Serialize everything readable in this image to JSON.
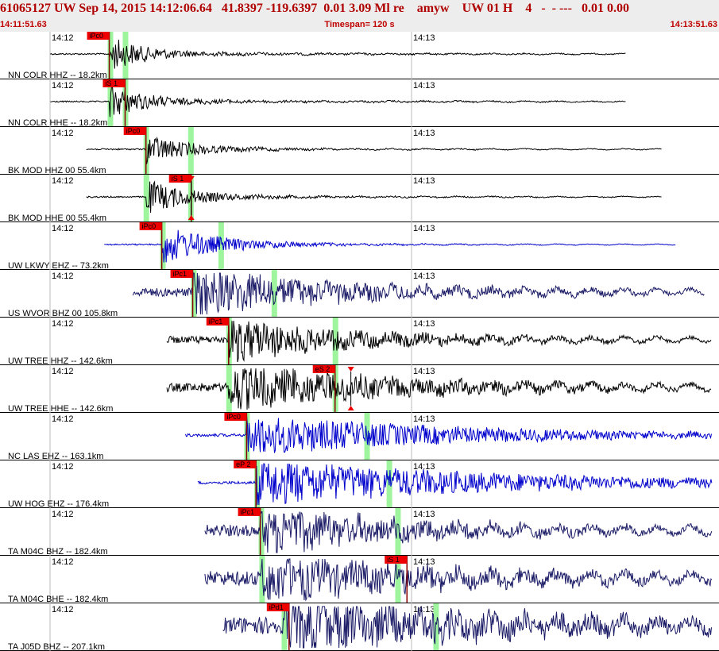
{
  "header": {
    "title": "61065127 UW Sep 14, 2015 14:12:06.64   41.8397 -119.6397  0.01 3.09 Ml re    amyw    UW 01 H    4   -  - ---   0.01 0.00",
    "start_time": "14:11:51.63",
    "timespan": "Timespan= 120 s",
    "end_time": "14:13:51.63"
  },
  "tick_labels": [
    "14:12",
    "14:13"
  ],
  "colors": {
    "black": "#000000",
    "blue": "#0000cc",
    "navy": "#1a1a66",
    "pick": "#ee0000",
    "window": "#9ef59e"
  },
  "traces": [
    {
      "label": "NN COLR HHZ -- 18.2km",
      "color": "black",
      "start": 0.07,
      "arrival": 0.152,
      "end": 0.87,
      "amp": 0.35,
      "noise": 0.01,
      "decay": 0.05,
      "coda": 0.1,
      "picks": [
        {
          "text": "iPc0",
          "x": 0.152,
          "label_at": "top"
        }
      ],
      "windows": [
        0.153,
        0.174
      ],
      "triangles": []
    },
    {
      "label": "NN COLR HHE -- 18.2km",
      "color": "black",
      "start": 0.07,
      "arrival": 0.152,
      "end": 0.87,
      "amp": 0.35,
      "noise": 0.01,
      "decay": 0.05,
      "coda": 0.1,
      "picks": [
        {
          "text": "iS 1",
          "x": 0.174,
          "label_at": "top"
        }
      ],
      "windows": [
        0.153,
        0.174
      ],
      "triangles": []
    },
    {
      "label": "BK MOD HHZ 00 55.4km",
      "color": "black",
      "start": 0.12,
      "arrival": 0.203,
      "end": 0.92,
      "amp": 0.3,
      "noise": 0.01,
      "decay": 0.06,
      "coda": 0.08,
      "picks": [
        {
          "text": "iPc0",
          "x": 0.203,
          "label_at": "top"
        }
      ],
      "windows": [
        0.203,
        0.265
      ],
      "triangles": []
    },
    {
      "label": "BK MOD HHE 00 55.4km",
      "color": "black",
      "start": 0.12,
      "arrival": 0.203,
      "end": 0.92,
      "amp": 0.35,
      "noise": 0.01,
      "decay": 0.06,
      "coda": 0.08,
      "picks": [
        {
          "text": "iS 1",
          "x": 0.266,
          "label_at": "top"
        }
      ],
      "windows": [
        0.203,
        0.265
      ],
      "triangles": [
        0.266
      ]
    },
    {
      "label": "UW LKWY EHZ -- 73.2km",
      "color": "blue",
      "start": 0.145,
      "arrival": 0.225,
      "end": 0.94,
      "amp": 0.4,
      "noise": 0.01,
      "decay": 0.08,
      "coda": 0.05,
      "picks": [
        {
          "text": "iPc0",
          "x": 0.225,
          "label_at": "top"
        }
      ],
      "windows": [
        0.226,
        0.307
      ],
      "triangles": []
    },
    {
      "label": "US WVOR BHZ 00 105.8km",
      "color": "navy",
      "start": 0.185,
      "arrival": 0.268,
      "end": 0.98,
      "amp": 0.45,
      "noise": 0.06,
      "decay": 0.15,
      "coda": 0.3,
      "picks": [
        {
          "text": "iPc1",
          "x": 0.268,
          "label_at": "top"
        }
      ],
      "windows": [
        0.269,
        0.381
      ],
      "triangles": []
    },
    {
      "label": "UW TREE HHZ -- 142.6km",
      "color": "black",
      "start": 0.232,
      "arrival": 0.318,
      "end": 0.99,
      "amp": 0.4,
      "noise": 0.05,
      "decay": 0.14,
      "coda": 0.25,
      "picks": [
        {
          "text": "iPc1",
          "x": 0.318,
          "label_at": "top"
        }
      ],
      "windows": [
        0.318,
        0.466
      ],
      "triangles": []
    },
    {
      "label": "UW TREE HHE -- 142.6km",
      "color": "black",
      "start": 0.232,
      "arrival": 0.318,
      "end": 0.99,
      "amp": 0.4,
      "noise": 0.06,
      "decay": 0.2,
      "coda": 0.3,
      "picks": [
        {
          "text": "eS 2",
          "x": 0.466,
          "label_at": "top"
        }
      ],
      "windows": [
        0.318,
        0.466
      ],
      "triangles": [
        0.488
      ]
    },
    {
      "label": "NC LAS EHZ -- 163.1km",
      "color": "blue",
      "start": 0.258,
      "arrival": 0.343,
      "end": 0.99,
      "amp": 0.35,
      "noise": 0.02,
      "decay": 0.25,
      "coda": 0.3,
      "picks": [
        {
          "text": "iPc0",
          "x": 0.343,
          "label_at": "top"
        }
      ],
      "windows": [
        0.343,
        0.51
      ],
      "triangles": []
    },
    {
      "label": "UW HOG EHZ -- 176.4km",
      "color": "blue",
      "start": 0.275,
      "arrival": 0.356,
      "end": 0.99,
      "amp": 0.38,
      "noise": 0.02,
      "decay": 0.3,
      "coda": 0.35,
      "picks": [
        {
          "text": "eP 2",
          "x": 0.356,
          "label_at": "top"
        }
      ],
      "windows": [
        0.357,
        0.541
      ],
      "triangles": []
    },
    {
      "label": "TA M04C BHZ -- 182.4km",
      "color": "navy",
      "start": 0.285,
      "arrival": 0.362,
      "end": 0.99,
      "amp": 0.4,
      "noise": 0.08,
      "decay": 0.2,
      "coda": 0.3,
      "picks": [
        {
          "text": "iPc1",
          "x": 0.362,
          "label_at": "top"
        }
      ],
      "windows": [
        0.363,
        0.553
      ],
      "triangles": []
    },
    {
      "label": "TA M04C BHE -- 182.4km",
      "color": "navy",
      "start": 0.285,
      "arrival": 0.362,
      "end": 0.99,
      "amp": 0.38,
      "noise": 0.1,
      "decay": 0.25,
      "coda": 0.35,
      "picks": [
        {
          "text": "iS 1",
          "x": 0.566,
          "label_at": "top"
        }
      ],
      "windows": [
        0.364,
        0.553
      ],
      "triangles": []
    },
    {
      "label": "TA J05D BHZ -- 207.1km",
      "color": "navy",
      "start": 0.31,
      "arrival": 0.395,
      "end": 0.99,
      "amp": 0.45,
      "noise": 0.12,
      "decay": 0.3,
      "coda": 0.4,
      "picks": [
        {
          "text": "iPd1",
          "x": 0.402,
          "label_at": "top"
        }
      ],
      "windows": [
        0.395,
        0.606
      ],
      "triangles": []
    }
  ]
}
